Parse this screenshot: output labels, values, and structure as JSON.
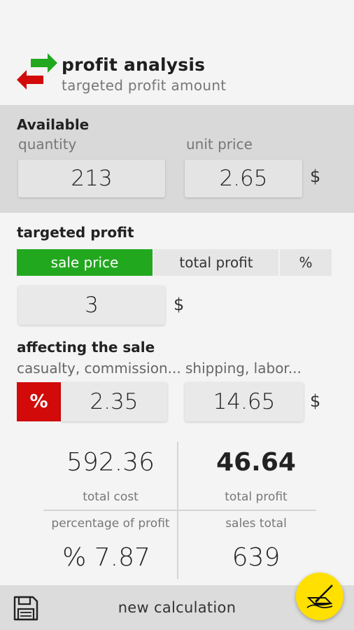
{
  "header": {
    "title": "profit analysis",
    "subtitle": "targeted profit amount",
    "logo_icon": "swap-arrows-icon"
  },
  "available": {
    "title": "Available",
    "quantity_label": "quantity",
    "quantity_value": "213",
    "unit_price_label": "unit price",
    "unit_price_value": "2.65",
    "currency": "$"
  },
  "targeted_profit": {
    "title": "targeted profit",
    "tabs": [
      {
        "label": "sale price",
        "active": true
      },
      {
        "label": "total profit",
        "active": false
      },
      {
        "label": "%",
        "active": false
      }
    ],
    "value": "3",
    "currency": "$"
  },
  "affecting_sale": {
    "title": "affecting the sale",
    "casualty_label": "casualty, commission...",
    "shipping_label": "shipping, labor...",
    "percent_toggle": "%",
    "casualty_value": "2.35",
    "shipping_value": "14.65",
    "currency": "$"
  },
  "stats": {
    "total_cost_value": "592.36",
    "total_cost_label": "total cost",
    "total_profit_value": "46.64",
    "total_profit_label": "total profit",
    "percentage_label": "percentage of profit",
    "percentage_value": "% 7.87",
    "sales_total_label": "sales total",
    "sales_total_value": "639"
  },
  "bottom_bar": {
    "new_calculation_label": "new calculation",
    "save_icon": "floppy-disk-icon",
    "fab_icon": "signature-pen-icon"
  },
  "colors": {
    "accent_green": "#22a81f",
    "accent_red": "#d20a0a",
    "fab_yellow": "#ffe000"
  }
}
